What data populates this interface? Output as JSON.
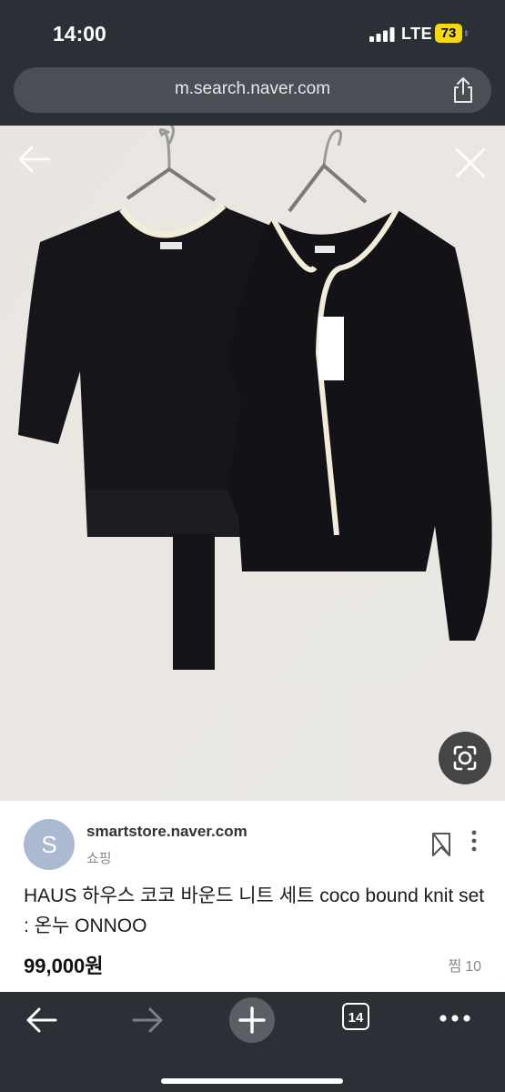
{
  "status_bar": {
    "time": "14:00",
    "network": "LTE",
    "battery": "73"
  },
  "browser": {
    "url": "m.search.naver.com"
  },
  "product": {
    "store_initial": "S",
    "store_name": "smartstore.naver.com",
    "category": "쇼핑",
    "title": "HAUS 하우스 코코 바운드 니트 세트 coco bound knit set : 온누 ONNOO",
    "price": "99,000원",
    "wish_label": "찜",
    "wish_count": "10"
  },
  "toolbar": {
    "tab_count": "14"
  },
  "icons": {
    "back": "arrow-left-icon",
    "forward": "arrow-right-icon",
    "new_tab": "plus-icon",
    "tabs": "tab-switcher-icon",
    "more": "more-horizontal-icon",
    "share": "share-icon",
    "close": "close-icon",
    "lens": "image-search-icon",
    "bookmark": "bookmark-icon"
  },
  "colors": {
    "chrome": "#2b3037",
    "url_bar": "#4a4f56",
    "battery": "#f5d90a",
    "avatar": "#aabbd1"
  }
}
